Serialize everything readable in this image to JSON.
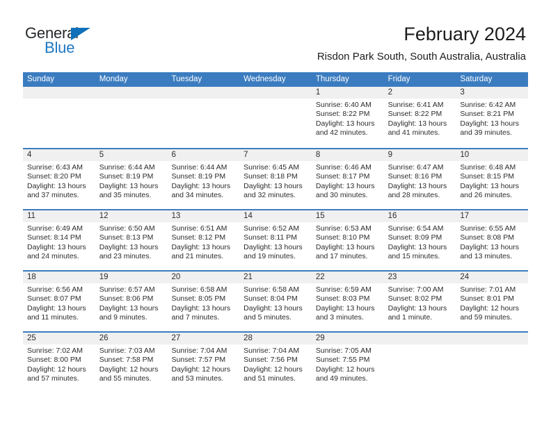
{
  "branding": {
    "name_part1": "General",
    "name_part2": "Blue",
    "accent_color": "#1b77c4",
    "triangle_color": "#1070ba"
  },
  "header": {
    "title": "February 2024",
    "subtitle": "Risdon Park South, South Australia, Australia"
  },
  "theme": {
    "header_blue": "#3b7cc0",
    "daynum_band": "#f0f0f0",
    "text": "#2b2b2b"
  },
  "weekdays": [
    "Sunday",
    "Monday",
    "Tuesday",
    "Wednesday",
    "Thursday",
    "Friday",
    "Saturday"
  ],
  "weeks": [
    [
      {
        "day": "",
        "lines": [
          "",
          "",
          "",
          ""
        ]
      },
      {
        "day": "",
        "lines": [
          "",
          "",
          "",
          ""
        ]
      },
      {
        "day": "",
        "lines": [
          "",
          "",
          "",
          ""
        ]
      },
      {
        "day": "",
        "lines": [
          "",
          "",
          "",
          ""
        ]
      },
      {
        "day": "1",
        "lines": [
          "Sunrise: 6:40 AM",
          "Sunset: 8:22 PM",
          "Daylight: 13 hours",
          "and 42 minutes."
        ]
      },
      {
        "day": "2",
        "lines": [
          "Sunrise: 6:41 AM",
          "Sunset: 8:22 PM",
          "Daylight: 13 hours",
          "and 41 minutes."
        ]
      },
      {
        "day": "3",
        "lines": [
          "Sunrise: 6:42 AM",
          "Sunset: 8:21 PM",
          "Daylight: 13 hours",
          "and 39 minutes."
        ]
      }
    ],
    [
      {
        "day": "4",
        "lines": [
          "Sunrise: 6:43 AM",
          "Sunset: 8:20 PM",
          "Daylight: 13 hours",
          "and 37 minutes."
        ]
      },
      {
        "day": "5",
        "lines": [
          "Sunrise: 6:44 AM",
          "Sunset: 8:19 PM",
          "Daylight: 13 hours",
          "and 35 minutes."
        ]
      },
      {
        "day": "6",
        "lines": [
          "Sunrise: 6:44 AM",
          "Sunset: 8:19 PM",
          "Daylight: 13 hours",
          "and 34 minutes."
        ]
      },
      {
        "day": "7",
        "lines": [
          "Sunrise: 6:45 AM",
          "Sunset: 8:18 PM",
          "Daylight: 13 hours",
          "and 32 minutes."
        ]
      },
      {
        "day": "8",
        "lines": [
          "Sunrise: 6:46 AM",
          "Sunset: 8:17 PM",
          "Daylight: 13 hours",
          "and 30 minutes."
        ]
      },
      {
        "day": "9",
        "lines": [
          "Sunrise: 6:47 AM",
          "Sunset: 8:16 PM",
          "Daylight: 13 hours",
          "and 28 minutes."
        ]
      },
      {
        "day": "10",
        "lines": [
          "Sunrise: 6:48 AM",
          "Sunset: 8:15 PM",
          "Daylight: 13 hours",
          "and 26 minutes."
        ]
      }
    ],
    [
      {
        "day": "11",
        "lines": [
          "Sunrise: 6:49 AM",
          "Sunset: 8:14 PM",
          "Daylight: 13 hours",
          "and 24 minutes."
        ]
      },
      {
        "day": "12",
        "lines": [
          "Sunrise: 6:50 AM",
          "Sunset: 8:13 PM",
          "Daylight: 13 hours",
          "and 23 minutes."
        ]
      },
      {
        "day": "13",
        "lines": [
          "Sunrise: 6:51 AM",
          "Sunset: 8:12 PM",
          "Daylight: 13 hours",
          "and 21 minutes."
        ]
      },
      {
        "day": "14",
        "lines": [
          "Sunrise: 6:52 AM",
          "Sunset: 8:11 PM",
          "Daylight: 13 hours",
          "and 19 minutes."
        ]
      },
      {
        "day": "15",
        "lines": [
          "Sunrise: 6:53 AM",
          "Sunset: 8:10 PM",
          "Daylight: 13 hours",
          "and 17 minutes."
        ]
      },
      {
        "day": "16",
        "lines": [
          "Sunrise: 6:54 AM",
          "Sunset: 8:09 PM",
          "Daylight: 13 hours",
          "and 15 minutes."
        ]
      },
      {
        "day": "17",
        "lines": [
          "Sunrise: 6:55 AM",
          "Sunset: 8:08 PM",
          "Daylight: 13 hours",
          "and 13 minutes."
        ]
      }
    ],
    [
      {
        "day": "18",
        "lines": [
          "Sunrise: 6:56 AM",
          "Sunset: 8:07 PM",
          "Daylight: 13 hours",
          "and 11 minutes."
        ]
      },
      {
        "day": "19",
        "lines": [
          "Sunrise: 6:57 AM",
          "Sunset: 8:06 PM",
          "Daylight: 13 hours",
          "and 9 minutes."
        ]
      },
      {
        "day": "20",
        "lines": [
          "Sunrise: 6:58 AM",
          "Sunset: 8:05 PM",
          "Daylight: 13 hours",
          "and 7 minutes."
        ]
      },
      {
        "day": "21",
        "lines": [
          "Sunrise: 6:58 AM",
          "Sunset: 8:04 PM",
          "Daylight: 13 hours",
          "and 5 minutes."
        ]
      },
      {
        "day": "22",
        "lines": [
          "Sunrise: 6:59 AM",
          "Sunset: 8:03 PM",
          "Daylight: 13 hours",
          "and 3 minutes."
        ]
      },
      {
        "day": "23",
        "lines": [
          "Sunrise: 7:00 AM",
          "Sunset: 8:02 PM",
          "Daylight: 13 hours",
          "and 1 minute."
        ]
      },
      {
        "day": "24",
        "lines": [
          "Sunrise: 7:01 AM",
          "Sunset: 8:01 PM",
          "Daylight: 12 hours",
          "and 59 minutes."
        ]
      }
    ],
    [
      {
        "day": "25",
        "lines": [
          "Sunrise: 7:02 AM",
          "Sunset: 8:00 PM",
          "Daylight: 12 hours",
          "and 57 minutes."
        ]
      },
      {
        "day": "26",
        "lines": [
          "Sunrise: 7:03 AM",
          "Sunset: 7:58 PM",
          "Daylight: 12 hours",
          "and 55 minutes."
        ]
      },
      {
        "day": "27",
        "lines": [
          "Sunrise: 7:04 AM",
          "Sunset: 7:57 PM",
          "Daylight: 12 hours",
          "and 53 minutes."
        ]
      },
      {
        "day": "28",
        "lines": [
          "Sunrise: 7:04 AM",
          "Sunset: 7:56 PM",
          "Daylight: 12 hours",
          "and 51 minutes."
        ]
      },
      {
        "day": "29",
        "lines": [
          "Sunrise: 7:05 AM",
          "Sunset: 7:55 PM",
          "Daylight: 12 hours",
          "and 49 minutes."
        ]
      },
      {
        "day": "",
        "lines": [
          "",
          "",
          "",
          ""
        ]
      },
      {
        "day": "",
        "lines": [
          "",
          "",
          "",
          ""
        ]
      }
    ]
  ]
}
